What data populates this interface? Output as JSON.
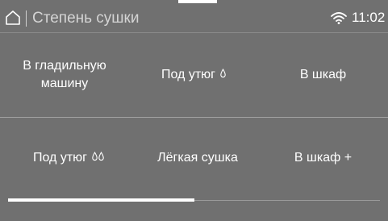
{
  "header": {
    "title": "Степень сушки",
    "time": "11:02",
    "icons": {
      "home": "home-icon",
      "wifi": "wifi-icon"
    }
  },
  "options": [
    {
      "line1": "В гладильную",
      "line2": "машину"
    },
    {
      "label": "Под утюг",
      "drops": 1
    },
    {
      "label": "В шкаф"
    },
    {
      "label": "Под утюг",
      "drops": 2
    },
    {
      "label": "Лёгкая сушка"
    },
    {
      "label": "В шкаф +"
    }
  ],
  "scroll": {
    "position_fraction": 0.5
  },
  "colors": {
    "background": "#707070",
    "text": "#ffffff",
    "title_text": "#d4d4d4"
  }
}
